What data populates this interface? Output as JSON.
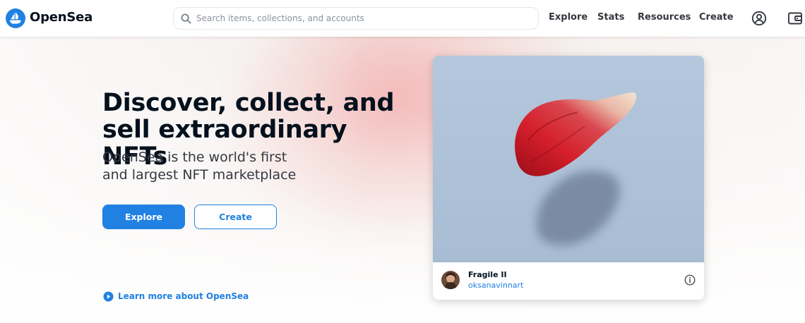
{
  "header": {
    "brand": "OpenSea",
    "logo_icon": "opensea-logo-icon",
    "search": {
      "placeholder": "Search items, collections, and accounts",
      "value": ""
    },
    "nav": [
      "Explore",
      "Stats",
      "Resources",
      "Create"
    ],
    "account_icon": "account-icon",
    "wallet_icon": "wallet-icon"
  },
  "hero": {
    "headline": "Discover, collect, and sell extraordinary NFTs",
    "subline": "OpenSea is the world's first and largest NFT marketplace",
    "explore_button": "Explore",
    "create_button": "Create",
    "learn_more": "Learn more about OpenSea"
  },
  "featured": {
    "title": "Fragile II",
    "creator": "oksanavinnart",
    "info_icon": "info-icon"
  },
  "colors": {
    "accent": "#2081e2",
    "text": "#04111d"
  }
}
